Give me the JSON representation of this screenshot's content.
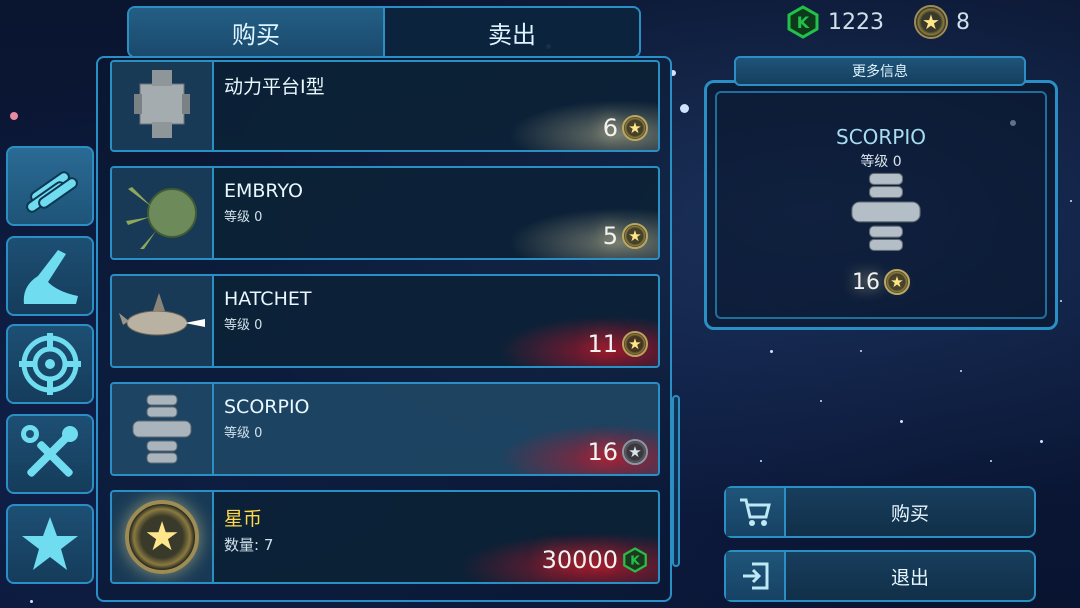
{
  "tabs": {
    "buy": "购买",
    "sell": "卖出"
  },
  "currency": {
    "gems": "1223",
    "stars": "8"
  },
  "categories": [
    {
      "name": "parts-icon"
    },
    {
      "name": "hull-icon"
    },
    {
      "name": "target-icon"
    },
    {
      "name": "tools-icon"
    },
    {
      "name": "star-icon"
    }
  ],
  "items": [
    {
      "name": "动力平台I型",
      "level": "",
      "price": "6",
      "currency": "star"
    },
    {
      "name": "EMBRYO",
      "level": "等级 0",
      "price": "5",
      "currency": "star"
    },
    {
      "name": "HATCHET",
      "level": "等级 0",
      "price": "11",
      "currency": "star"
    },
    {
      "name": "SCORPIO",
      "level": "等级 0",
      "price": "16",
      "currency": "star"
    },
    {
      "name": "星币",
      "level": "数量: 7",
      "price": "30000",
      "currency": "gem"
    }
  ],
  "info": {
    "tab_label": "更多信息",
    "name": "SCORPIO",
    "level": "等级 0",
    "price": "16"
  },
  "actions": {
    "buy": "购买",
    "exit": "退出"
  },
  "colors": {
    "accent": "#2a8fc4",
    "gem": "#22c24a",
    "star": "#ffe68a"
  }
}
